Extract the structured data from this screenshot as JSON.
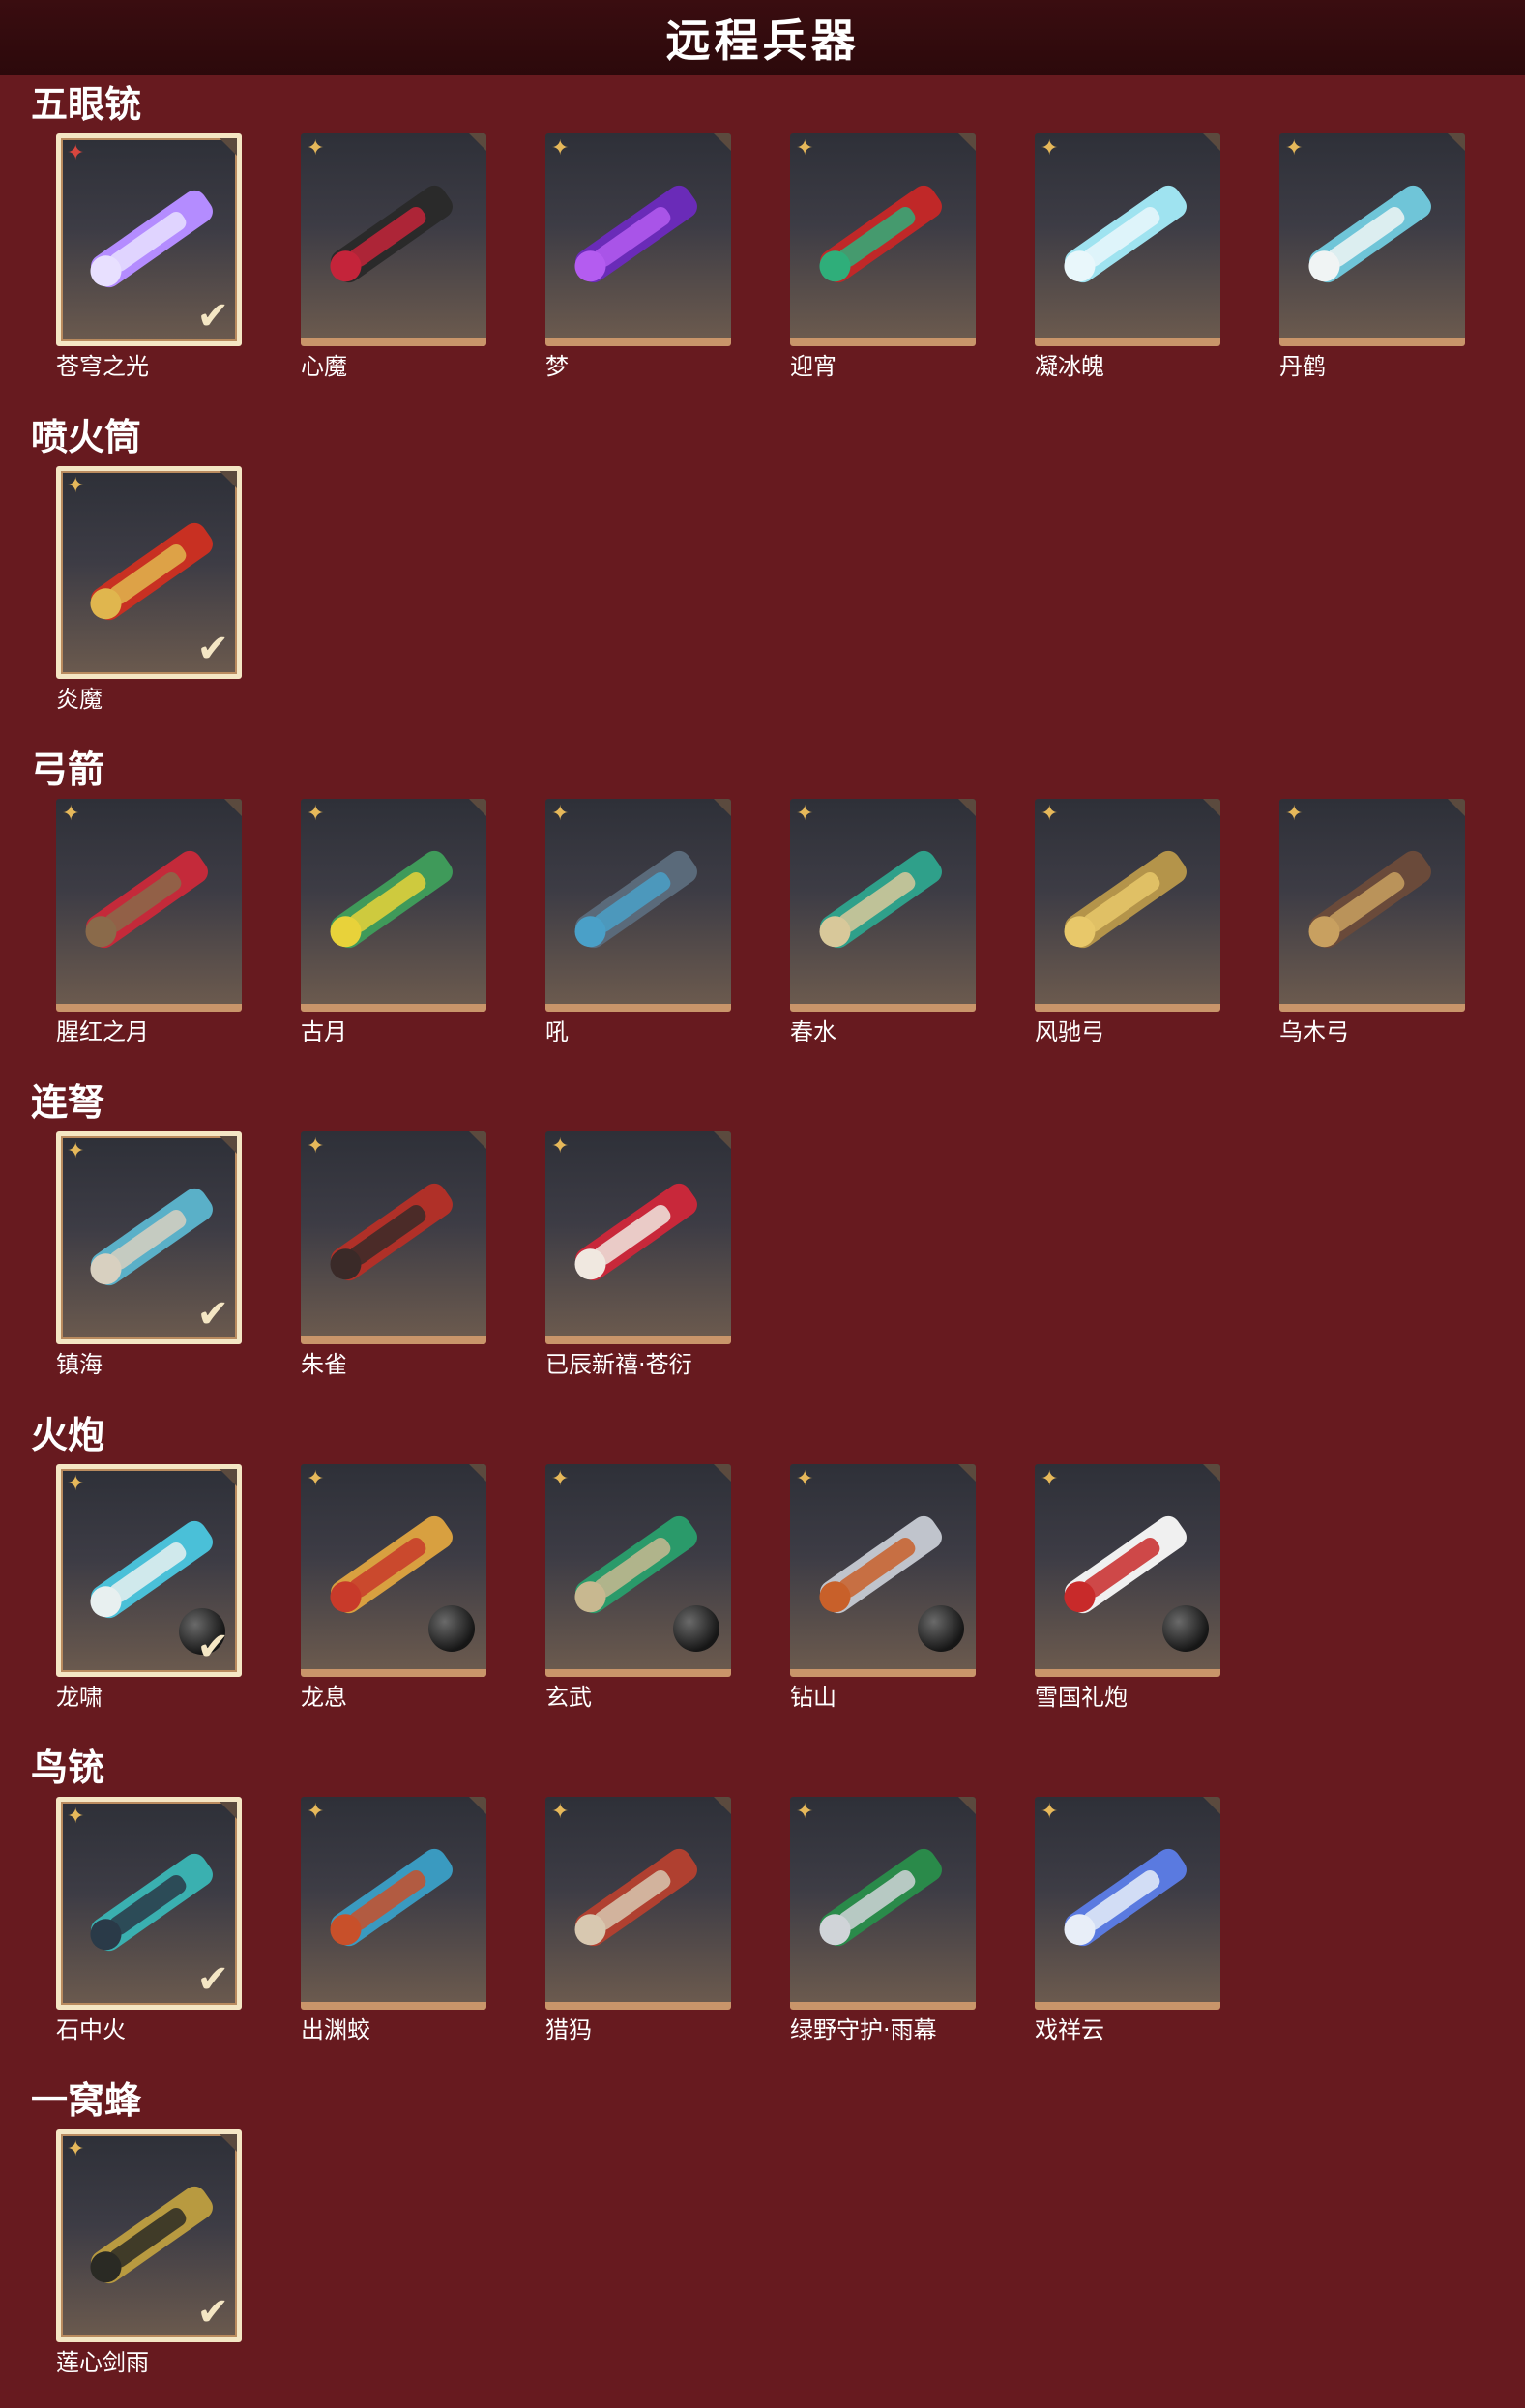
{
  "header": {
    "title": "远程兵器"
  },
  "colors": {
    "background": "#671a1f",
    "header": "#2c090b",
    "card_border": "#c9956a",
    "selected_border": "#f4e6c4",
    "rank_gold": "#e6b85a",
    "rank_red": "#d8463e"
  },
  "sections": [
    {
      "title": "五眼铳",
      "items": [
        {
          "name": "苍穹之光",
          "selected": true,
          "rank": "red",
          "palette": [
            "#b48cff",
            "#e8e0ff"
          ]
        },
        {
          "name": "心魔",
          "selected": false,
          "rank": "gold",
          "palette": [
            "#2a2a2a",
            "#c4243a"
          ]
        },
        {
          "name": "梦",
          "selected": false,
          "rank": "gold",
          "palette": [
            "#6a2bb8",
            "#b45cf0"
          ]
        },
        {
          "name": "迎宵",
          "selected": false,
          "rank": "gold",
          "palette": [
            "#c02828",
            "#2fae7a"
          ]
        },
        {
          "name": "凝冰魄",
          "selected": false,
          "rank": "gold",
          "palette": [
            "#9fe3f0",
            "#e9f7fb"
          ]
        },
        {
          "name": "丹鹤",
          "selected": false,
          "rank": "gold",
          "palette": [
            "#6fc5d8",
            "#f0f4f4"
          ]
        }
      ]
    },
    {
      "title": "喷火筒",
      "items": [
        {
          "name": "炎魔",
          "selected": true,
          "rank": "gold",
          "palette": [
            "#c83022",
            "#e0b64e"
          ]
        }
      ]
    },
    {
      "title": "弓箭",
      "items": [
        {
          "name": "腥红之月",
          "selected": false,
          "rank": "gold",
          "palette": [
            "#c42a3a",
            "#8a6a4a"
          ]
        },
        {
          "name": "古月",
          "selected": false,
          "rank": "gold",
          "palette": [
            "#3f9a5a",
            "#e8d23a"
          ]
        },
        {
          "name": "吼",
          "selected": false,
          "rank": "gold",
          "palette": [
            "#5a6a7a",
            "#4aa0c8"
          ]
        },
        {
          "name": "春水",
          "selected": false,
          "rank": "gold",
          "palette": [
            "#2fa08a",
            "#d8c89a"
          ]
        },
        {
          "name": "风驰弓",
          "selected": false,
          "rank": "gold",
          "palette": [
            "#b4944a",
            "#e8c86a"
          ]
        },
        {
          "name": "乌木弓",
          "selected": false,
          "rank": "gold",
          "palette": [
            "#6a4a3a",
            "#c8a060"
          ]
        }
      ]
    },
    {
      "title": "连弩",
      "items": [
        {
          "name": "镇海",
          "selected": true,
          "rank": "gold",
          "palette": [
            "#5ab0c8",
            "#d8d0c0"
          ]
        },
        {
          "name": "朱雀",
          "selected": false,
          "rank": "gold",
          "palette": [
            "#b03028",
            "#3a2a28"
          ]
        },
        {
          "name": "已辰新禧·苍衍",
          "selected": false,
          "rank": "gold",
          "palette": [
            "#c8283a",
            "#f0e8e0"
          ]
        }
      ]
    },
    {
      "title": "火炮",
      "items": [
        {
          "name": "龙啸",
          "selected": true,
          "rank": "gold",
          "palette": [
            "#4ac0d8",
            "#e8f0f0"
          ],
          "ammo": true
        },
        {
          "name": "龙息",
          "selected": false,
          "rank": "gold",
          "palette": [
            "#d8a040",
            "#c83a2a"
          ],
          "ammo": true
        },
        {
          "name": "玄武",
          "selected": false,
          "rank": "gold",
          "palette": [
            "#2a9a6a",
            "#c8b890"
          ],
          "ammo": true
        },
        {
          "name": "钻山",
          "selected": false,
          "rank": "gold",
          "palette": [
            "#c0c4cc",
            "#c8602a"
          ],
          "ammo": true
        },
        {
          "name": "雪国礼炮",
          "selected": false,
          "rank": "gold",
          "palette": [
            "#f0f0f0",
            "#c82a2a"
          ],
          "ammo": true
        }
      ]
    },
    {
      "title": "鸟铳",
      "items": [
        {
          "name": "石中火",
          "selected": true,
          "rank": "gold",
          "palette": [
            "#3ab0b0",
            "#2a3a48"
          ]
        },
        {
          "name": "出渊蛟",
          "selected": false,
          "rank": "gold",
          "palette": [
            "#3a9ac0",
            "#c8502a"
          ]
        },
        {
          "name": "猎犸",
          "selected": false,
          "rank": "gold",
          "palette": [
            "#b04030",
            "#d8c8b0"
          ]
        },
        {
          "name": "绿野守护·雨幕",
          "selected": false,
          "rank": "gold",
          "palette": [
            "#2a8a4a",
            "#d0d4d8"
          ]
        },
        {
          "name": "戏祥云",
          "selected": false,
          "rank": "gold",
          "palette": [
            "#5a7ae0",
            "#e8eef8"
          ]
        }
      ]
    },
    {
      "title": "一窝蜂",
      "items": [
        {
          "name": "莲心剑雨",
          "selected": true,
          "rank": "gold",
          "palette": [
            "#b89a40",
            "#2a2a24"
          ]
        }
      ]
    }
  ]
}
